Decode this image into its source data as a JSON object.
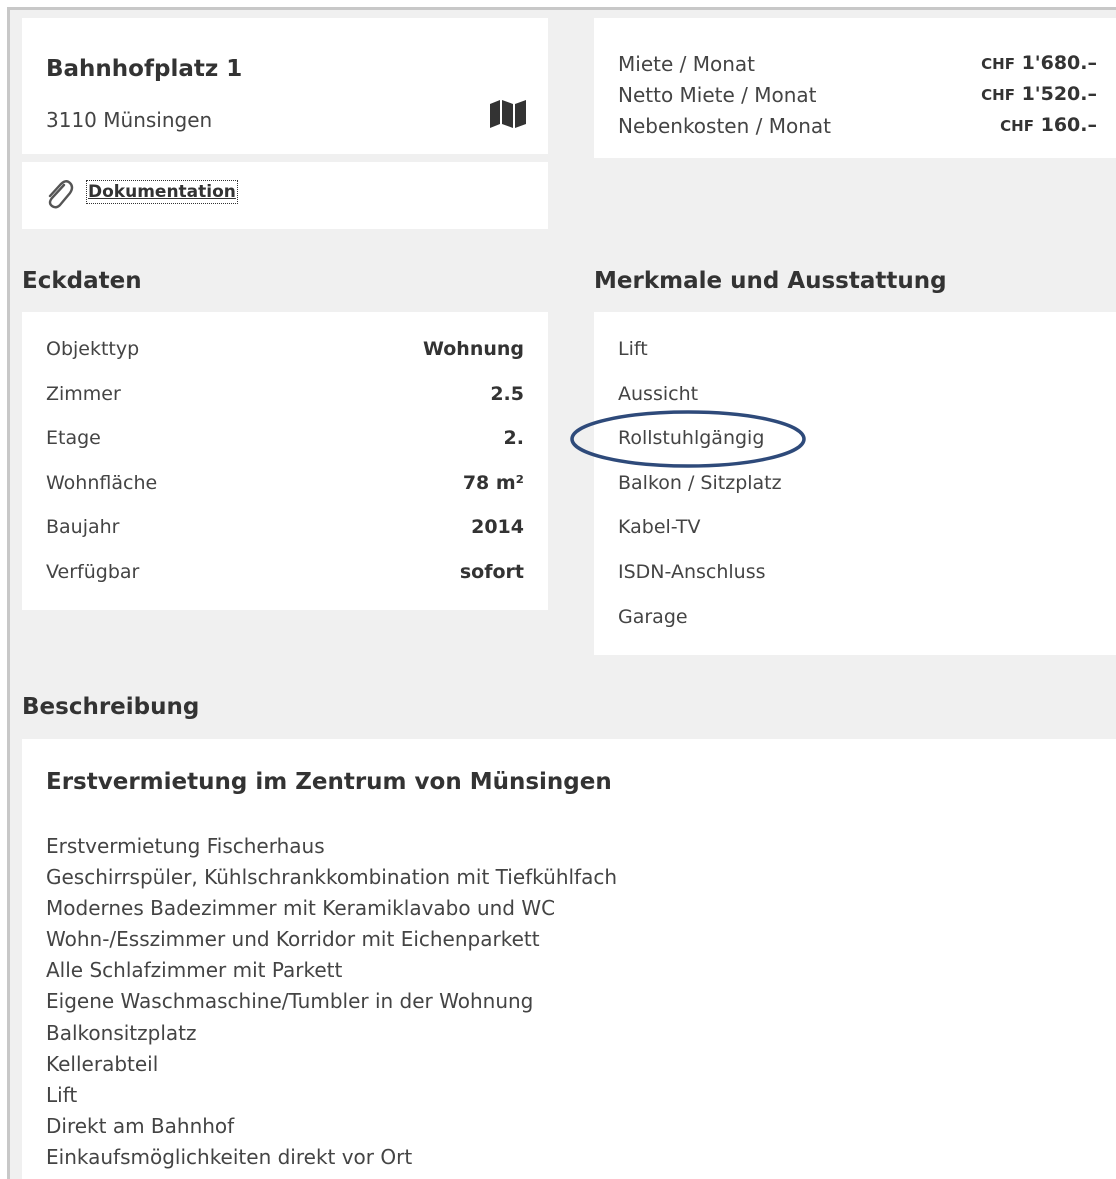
{
  "address": {
    "street": "Bahnhofplatz 1",
    "city": "3110 Münsingen",
    "map_icon": "map-icon"
  },
  "documentation": {
    "icon": "paperclip-icon",
    "link_label": "Dokumentation"
  },
  "prices": [
    {
      "label": "Miete / Monat",
      "currency": "CHF",
      "amount": "1'680.–"
    },
    {
      "label": "Netto Miete / Monat",
      "currency": "CHF",
      "amount": "1'520.–"
    },
    {
      "label": "Nebenkosten / Monat",
      "currency": "CHF",
      "amount": "160.–"
    }
  ],
  "eckdaten": {
    "heading": "Eckdaten",
    "rows": [
      {
        "label": "Objekttyp",
        "value": "Wohnung"
      },
      {
        "label": "Zimmer",
        "value": "2.5"
      },
      {
        "label": "Etage",
        "value": "2."
      },
      {
        "label": "Wohnfläche",
        "value": "78 m²"
      },
      {
        "label": "Baujahr",
        "value": "2014"
      },
      {
        "label": "Verfügbar",
        "value": "sofort"
      }
    ]
  },
  "merkmale": {
    "heading": "Merkmale und Ausstattung",
    "items": [
      "Lift",
      "Aussicht",
      "Rollstuhlgängig",
      "Balkon / Sitzplatz",
      "Kabel-TV",
      "ISDN-Anschluss",
      "Garage"
    ],
    "highlighted_item": "Rollstuhlgängig",
    "highlight_color": "#2e4a7a"
  },
  "beschreibung": {
    "heading": "Beschreibung",
    "title": "Erstvermietung im Zentrum von Münsingen",
    "lines": [
      "Erstvermietung Fischerhaus",
      "Geschirrspüler, Kühlschrankkombination mit Tiefkühlfach",
      "Modernes Badezimmer mit Keramiklavabo und WC",
      "Wohn-/Esszimmer und Korridor mit Eichenparkett",
      "Alle Schlafzimmer mit Parkett",
      "Eigene Waschmaschine/Tumbler in der Wohnung",
      "Balkonsitzplatz",
      "Kellerabteil",
      "Lift",
      "Direkt am Bahnhof",
      "Einkaufsmöglichkeiten direkt vor Ort"
    ]
  },
  "colors": {
    "page_background": "#f0f0f0",
    "card_background": "#ffffff",
    "text": "#333333"
  }
}
